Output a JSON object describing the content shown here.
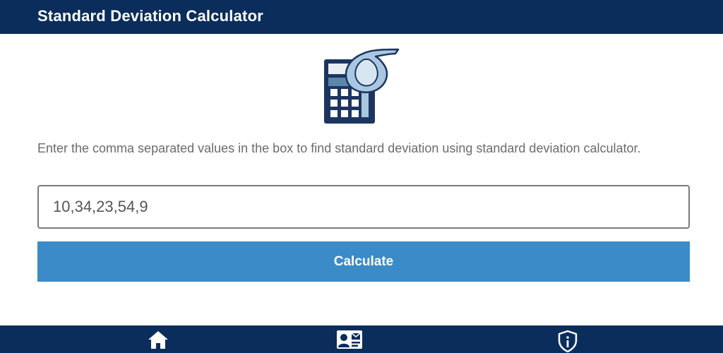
{
  "app": {
    "title": "Standard Deviation Calculator"
  },
  "logo": {
    "icon": "calculator-sigma-icon"
  },
  "main": {
    "description": "Enter the comma separated values in the box to find standard deviation using standard deviation calculator.",
    "input_value": "10,34,23,54,9",
    "calculate_label": "Calculate"
  },
  "bottom_nav": {
    "items": [
      {
        "icon": "home-icon"
      },
      {
        "icon": "contact-card-icon"
      },
      {
        "icon": "info-shield-icon"
      }
    ]
  },
  "colors": {
    "header_bg": "#0b2d5b",
    "button_bg": "#3a8bc8",
    "text_muted": "#6b6b6b"
  }
}
